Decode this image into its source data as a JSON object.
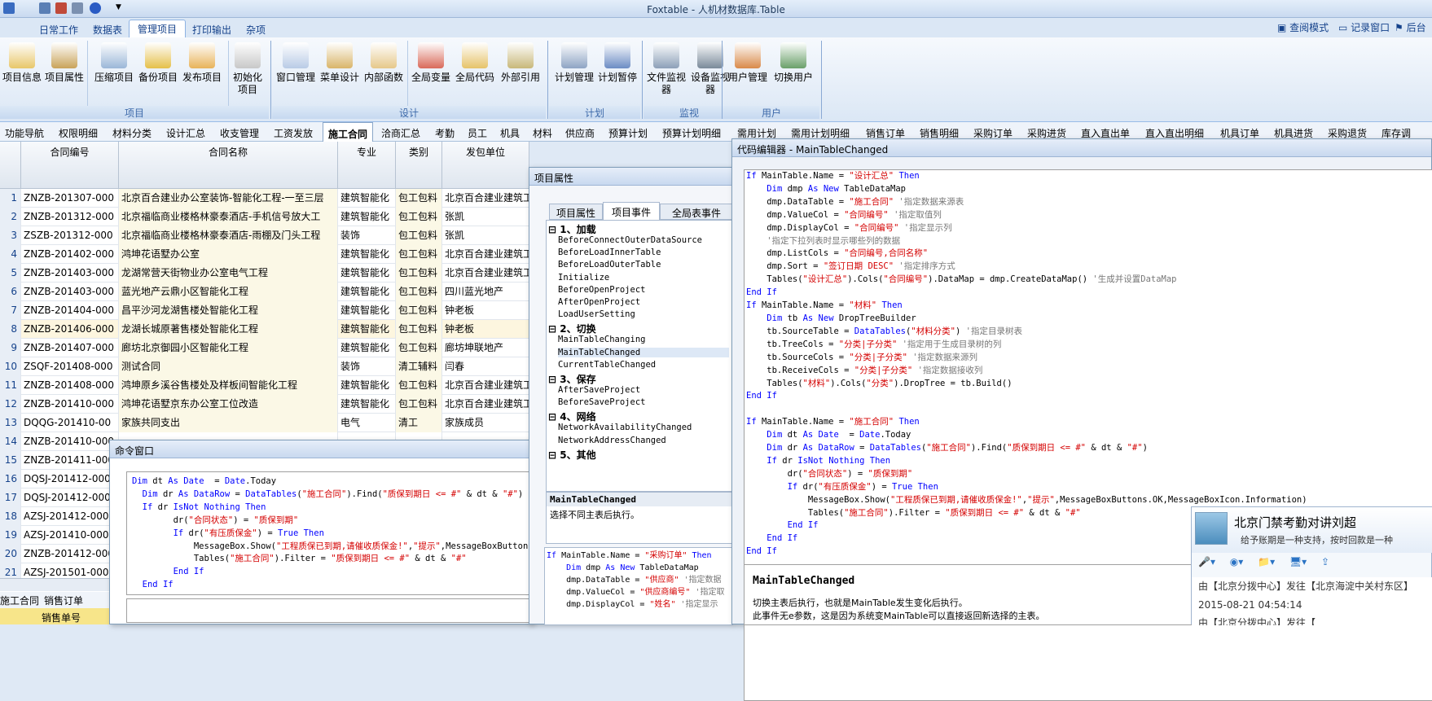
{
  "app": {
    "title": "Foxtable - 人机材数据库.Table"
  },
  "menu": {
    "tabs": [
      "日常工作",
      "数据表",
      "管理项目",
      "打印输出",
      "杂项"
    ],
    "active": "管理项目",
    "right": [
      "查阅模式",
      "记录窗口",
      "后台"
    ]
  },
  "ribbon": {
    "groups": [
      {
        "name": "项目",
        "buttons": [
          "项目信息",
          "项目属性",
          "压缩项目",
          "备份项目",
          "发布项目",
          "初始化项目"
        ]
      },
      {
        "name": "设计",
        "buttons": [
          "窗口管理",
          "菜单设计",
          "内部函数",
          "全局变量",
          "全局代码",
          "外部引用"
        ]
      },
      {
        "name": "计划",
        "buttons": [
          "计划管理",
          "计划暂停"
        ]
      },
      {
        "name": "监视",
        "buttons": [
          "文件监视器",
          "设备监视器"
        ]
      },
      {
        "name": "用户",
        "buttons": [
          "用户管理",
          "切换用户"
        ]
      }
    ]
  },
  "tables": {
    "tabs": [
      "功能导航",
      "权限明细",
      "材料分类",
      "设计汇总",
      "收支管理",
      "工资发放",
      "施工合同",
      "洽商汇总",
      "考勤",
      "员工",
      "机具",
      "材料",
      "供应商",
      "预算计划",
      "预算计划明细",
      "需用计划",
      "需用计划明细",
      "销售订单",
      "销售明细",
      "采购订单",
      "采购进货",
      "直入直出单",
      "直入直出明细",
      "机具订单",
      "机具进货",
      "采购退货",
      "库存调"
    ],
    "active": "施工合同"
  },
  "grid": {
    "columns": [
      "合同编号",
      "合同名称",
      "专业",
      "类别",
      "发包单位"
    ],
    "rows": [
      [
        "1",
        "ZNZB-201307-000",
        "北京百合建业办公室装饰-智能化工程-一至三层",
        "建筑智能化",
        "包工包料",
        "北京百合建业建筑工"
      ],
      [
        "2",
        "ZNZB-201312-000",
        "北京福临商业楼格林豪泰酒店-手机信号放大工",
        "建筑智能化",
        "包工包料",
        "张凯"
      ],
      [
        "3",
        "ZSZB-201312-000",
        "北京福临商业楼格林豪泰酒店-雨棚及门头工程",
        "装饰",
        "包工包料",
        "张凯"
      ],
      [
        "4",
        "ZNZB-201402-000",
        "鸿坤花语墅办公室",
        "建筑智能化",
        "包工包料",
        "北京百合建业建筑工"
      ],
      [
        "5",
        "ZNZB-201403-000",
        "龙湖常营天街物业办公室电气工程",
        "建筑智能化",
        "包工包料",
        "北京百合建业建筑工"
      ],
      [
        "6",
        "ZNZB-201403-000",
        "蓝光地产云鼎小区智能化工程",
        "建筑智能化",
        "包工包料",
        "四川蓝光地产"
      ],
      [
        "7",
        "ZNZB-201404-000",
        "昌平沙河龙湖售楼处智能化工程",
        "建筑智能化",
        "包工包料",
        "钟老板"
      ],
      [
        "8",
        "ZNZB-201406-000",
        "龙湖长城原著售楼处智能化工程",
        "建筑智能化",
        "包工包料",
        "钟老板"
      ],
      [
        "9",
        "ZNZB-201407-000",
        "廊坊北京御园小区智能化工程",
        "建筑智能化",
        "包工包料",
        "廊坊坤联地产"
      ],
      [
        "10",
        "ZSQF-201408-000",
        "测试合同",
        "装饰",
        "清工辅料",
        "闫春"
      ],
      [
        "11",
        "ZNZB-201408-000",
        "鸿坤原乡溪谷售楼处及样板间智能化工程",
        "建筑智能化",
        "包工包料",
        "北京百合建业建筑工"
      ],
      [
        "12",
        "ZNZB-201410-000",
        "鸿坤花语墅京东办公室工位改造",
        "建筑智能化",
        "包工包料",
        "北京百合建业建筑工"
      ],
      [
        "13",
        "DQQG-201410-00",
        "家族共同支出",
        "电气",
        "清工",
        "家族成员"
      ],
      [
        "14",
        "ZNZB-201410-000",
        "",
        "",
        "",
        ""
      ],
      [
        "15",
        "ZNZB-201411-000",
        "",
        "",
        "",
        ""
      ],
      [
        "16",
        "DQSJ-201412-000",
        "",
        "",
        "",
        ""
      ],
      [
        "17",
        "DQSJ-201412-000",
        "",
        "",
        "",
        ""
      ],
      [
        "18",
        "AZSJ-201412-0001",
        "",
        "",
        "",
        ""
      ],
      [
        "19",
        "AZSJ-201410-0001",
        "",
        "",
        "",
        ""
      ],
      [
        "20",
        "ZNZB-201412-000",
        "",
        "",
        "",
        ""
      ],
      [
        "21",
        "AZSJ-201501-0001",
        "",
        "",
        "",
        ""
      ]
    ]
  },
  "statusbar": {
    "tab1": "施工合同",
    "tab2": "销售订单",
    "bottom": "销售单号"
  },
  "command": {
    "title": "命令窗口",
    "code": [
      "Dim dt As Date  = Date.Today",
      "  Dim dr As DataRow = DataTables(\"施工合同\").Find(\"质保到期日 <= #\" & dt & \"#\")",
      "  If dr IsNot Nothing Then",
      "        dr(\"合同状态\") = \"质保到期\"",
      "        If dr(\"有压质保金\") = True Then",
      "            MessageBox.Show(\"工程质保已到期,请催收质保金!\",\"提示\",MessageBoxButtons",
      "            Tables(\"施工合同\").Filter = \"质保到期日 <= #\" & dt & \"#\"",
      "        End If",
      "  End If"
    ]
  },
  "props": {
    "title": "项目属性",
    "tabs": [
      "项目属性",
      "项目事件",
      "全局表事件"
    ],
    "active": "项目事件",
    "sections": [
      {
        "name": "1、加载",
        "items": [
          "BeforeConnectOuterDataSource",
          "BeforeLoadInnerTable",
          "BeforeLoadOuterTable",
          "Initialize",
          "BeforeOpenProject",
          "AfterOpenProject",
          "LoadUserSetting"
        ]
      },
      {
        "name": "2、切换",
        "items": [
          "MainTableChanging",
          "MainTableChanged",
          "CurrentTableChanged"
        ]
      },
      {
        "name": "3、保存",
        "items": [
          "AfterSaveProject",
          "BeforeSaveProject"
        ]
      },
      {
        "name": "4、网络",
        "items": [
          "NetworkAvailabilityChanged",
          "NetworkAddressChanged"
        ]
      },
      {
        "name": "5、其他",
        "items": []
      }
    ],
    "desc_title": "MainTableChanged",
    "desc": "选择不同主表后执行。",
    "code": [
      "If MainTable.Name = \"采购订单\" Then",
      "    Dim dmp As New TableDataMap",
      "    dmp.DataTable = \"供应商\" '指定数据",
      "    dmp.ValueCol = \"供应商编号\" '指定取",
      "    dmp.DisplayCol = \"姓名\" '指定显示"
    ]
  },
  "editor": {
    "title": "代码编辑器 - MainTableChanged",
    "code": [
      "If MainTable.Name = \"设计汇总\" Then",
      "    Dim dmp As New TableDataMap",
      "    dmp.DataTable = \"施工合同\" '指定数据来源表",
      "    dmp.ValueCol = \"合同编号\" '指定取值列",
      "    dmp.DisplayCol = \"合同编号\" '指定显示列",
      "    '指定下拉列表时显示哪些列的数据",
      "    dmp.ListCols = \"合同编号,合同名称\"",
      "    dmp.Sort = \"签订日期 DESC\" '指定排序方式",
      "    Tables(\"设计汇总\").Cols(\"合同编号\").DataMap = dmp.CreateDataMap() '生成并设置DataMap",
      "End If",
      "If MainTable.Name = \"材料\" Then",
      "    Dim tb As New DropTreeBuilder",
      "    tb.SourceTable = DataTables(\"材料分类\") '指定目录树表",
      "    tb.TreeCols = \"分类|子分类\" '指定用于生成目录树的列",
      "    tb.SourceCols = \"分类|子分类\" '指定数据来源列",
      "    tb.ReceiveCols = \"分类|子分类\" '指定数据接收列",
      "    Tables(\"材料\").Cols(\"分类\").DropTree = tb.Build()",
      "End If",
      "",
      "If MainTable.Name = \"施工合同\" Then",
      "    Dim dt As Date  = Date.Today",
      "    Dim dr As DataRow = DataTables(\"施工合同\").Find(\"质保到期日 <= #\" & dt & \"#\")",
      "    If dr IsNot Nothing Then",
      "        dr(\"合同状态\") = \"质保到期\"",
      "        If dr(\"有压质保金\") = True Then",
      "            MessageBox.Show(\"工程质保已到期,请催收质保金!\",\"提示\",MessageBoxButtons.OK,MessageBoxIcon.Information)",
      "            Tables(\"施工合同\").Filter = \"质保到期日 <= #\" & dt & \"#\"",
      "        End If",
      "    End If",
      "End If"
    ],
    "help_title": "MainTableChanged",
    "help1": "切换主表后执行，也就是MainTable发生变化后执行。",
    "help2": "此事件无e参数，这是因为系统变MainTable可以直接返回新选择的主表。"
  },
  "chat": {
    "title": "北京门禁考勤对讲刘超",
    "sub": "给予账期是一种支持，按时回款是一种",
    "line1": "由【北京分拨中心】发往【北京海淀中关村东区】",
    "time": "2015-08-21 04:54:14",
    "line2": "由【北京分拨中心】发往【"
  },
  "colors": {
    "accent": "#15428b",
    "ribbon": "#dbe7f5",
    "keyword": "#0000ff",
    "string": "#d40000"
  }
}
